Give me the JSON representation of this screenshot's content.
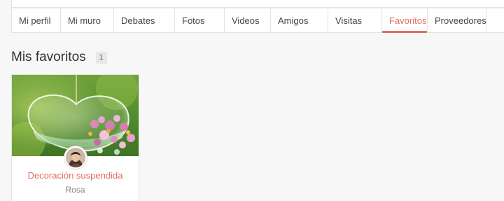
{
  "nav": {
    "tabs": [
      {
        "label": "Mi perfil"
      },
      {
        "label": "Mi muro"
      },
      {
        "label": "Debates"
      },
      {
        "label": "Fotos"
      },
      {
        "label": "Videos"
      },
      {
        "label": "Amigos"
      },
      {
        "label": "Visitas"
      },
      {
        "label": "Favoritos",
        "active": true
      },
      {
        "label": "Proveedores"
      }
    ],
    "accent_color": "#e06f62"
  },
  "main": {
    "title": "Mis favoritos",
    "count": "1"
  },
  "favorites": [
    {
      "title": "Decoración suspendida",
      "author": "Rosa",
      "image": "glass-heart-terrarium-with-flowers",
      "avatar": "user-avatar"
    }
  ]
}
